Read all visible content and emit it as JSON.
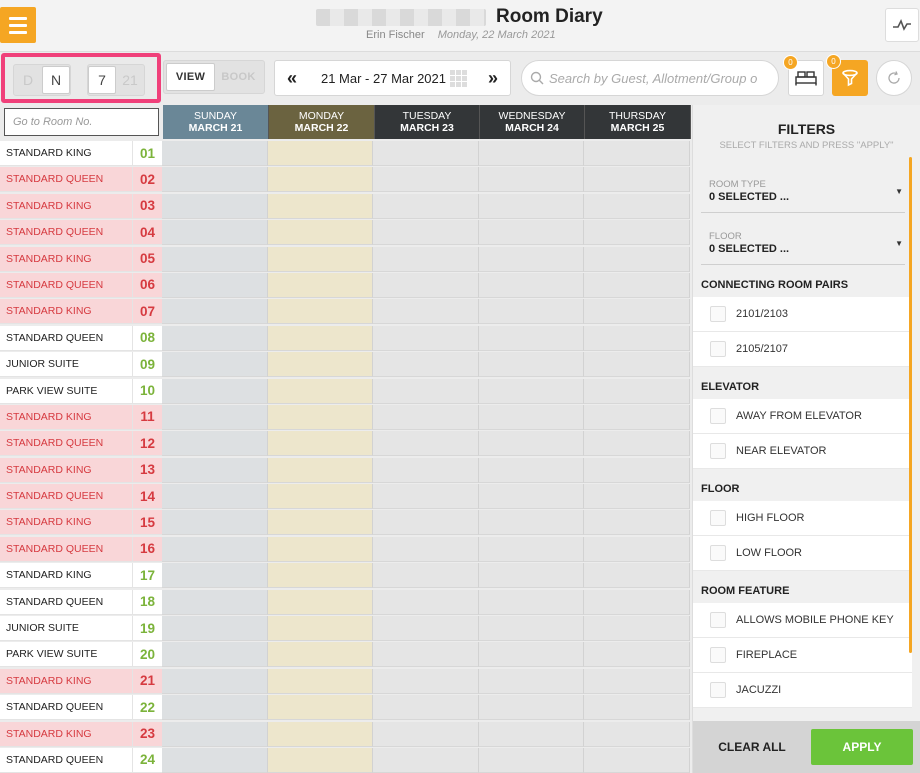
{
  "header": {
    "title": "Room Diary",
    "user": "Erin Fischer",
    "date": "Monday, 22 March 2021"
  },
  "toolbar": {
    "mode_d": "D",
    "mode_n": "N",
    "days_7": "7",
    "days_21": "21",
    "view_label": "VIEW",
    "book_label": "BOOK",
    "prev_icon": "«",
    "next_icon": "»",
    "date_range": "21 Mar - 27 Mar 2021",
    "search_placeholder": "Search by Guest, Allotment/Group o",
    "bed_badge": "0",
    "filter_badge": "0",
    "accent_color": "#f5a623",
    "highlight_color": "#f0407a"
  },
  "grid": {
    "room_search_placeholder": "Go to Room No.",
    "days": [
      {
        "day": "SUNDAY",
        "date": "MARCH 21",
        "color": "#6a8797"
      },
      {
        "day": "MONDAY",
        "date": "MARCH 22",
        "color": "#6b6340"
      },
      {
        "day": "TUESDAY",
        "date": "MARCH 23",
        "color": "#333638"
      },
      {
        "day": "WEDNESDAY",
        "date": "MARCH 24",
        "color": "#333638"
      },
      {
        "day": "THURSDAY",
        "date": "MARCH 25",
        "color": "#333638"
      }
    ],
    "rooms": [
      {
        "type": "STANDARD KING",
        "number": "01",
        "dirty": false
      },
      {
        "type": "STANDARD QUEEN",
        "number": "02",
        "dirty": true
      },
      {
        "type": "STANDARD KING",
        "number": "03",
        "dirty": true
      },
      {
        "type": "STANDARD QUEEN",
        "number": "04",
        "dirty": true
      },
      {
        "type": "STANDARD KING",
        "number": "05",
        "dirty": true
      },
      {
        "type": "STANDARD QUEEN",
        "number": "06",
        "dirty": true
      },
      {
        "type": "STANDARD KING",
        "number": "07",
        "dirty": true
      },
      {
        "type": "STANDARD QUEEN",
        "number": "08",
        "dirty": false
      },
      {
        "type": "JUNIOR SUITE",
        "number": "09",
        "dirty": false
      },
      {
        "type": "PARK VIEW SUITE",
        "number": "10",
        "dirty": false
      },
      {
        "type": "STANDARD KING",
        "number": "11",
        "dirty": true
      },
      {
        "type": "STANDARD QUEEN",
        "number": "12",
        "dirty": true
      },
      {
        "type": "STANDARD KING",
        "number": "13",
        "dirty": true
      },
      {
        "type": "STANDARD QUEEN",
        "number": "14",
        "dirty": true
      },
      {
        "type": "STANDARD KING",
        "number": "15",
        "dirty": true
      },
      {
        "type": "STANDARD QUEEN",
        "number": "16",
        "dirty": true
      },
      {
        "type": "STANDARD KING",
        "number": "17",
        "dirty": false
      },
      {
        "type": "STANDARD QUEEN",
        "number": "18",
        "dirty": false
      },
      {
        "type": "JUNIOR SUITE",
        "number": "19",
        "dirty": false
      },
      {
        "type": "PARK VIEW SUITE",
        "number": "20",
        "dirty": false
      },
      {
        "type": "STANDARD KING",
        "number": "21",
        "dirty": true
      },
      {
        "type": "STANDARD QUEEN",
        "number": "22",
        "dirty": false
      },
      {
        "type": "STANDARD KING",
        "number": "23",
        "dirty": true
      },
      {
        "type": "STANDARD QUEEN",
        "number": "24",
        "dirty": false
      }
    ]
  },
  "filters": {
    "title": "FILTERS",
    "subtitle": "SELECT FILTERS AND PRESS \"APPLY\"",
    "room_type_label": "ROOM TYPE",
    "room_type_value": "0 SELECTED ...",
    "floor_label": "FLOOR",
    "floor_value": "0 SELECTED ...",
    "sections": [
      {
        "title": "CONNECTING ROOM PAIRS",
        "options": [
          "2101/2103",
          "2105/2107"
        ]
      },
      {
        "title": "ELEVATOR",
        "options": [
          "AWAY FROM ELEVATOR",
          "NEAR ELEVATOR"
        ]
      },
      {
        "title": "FLOOR",
        "options": [
          "HIGH FLOOR",
          "LOW FLOOR"
        ]
      },
      {
        "title": "ROOM FEATURE",
        "options": [
          "ALLOWS MOBILE PHONE KEY",
          "FIREPLACE",
          "JACUZZI"
        ]
      }
    ],
    "clear_label": "CLEAR ALL",
    "apply_label": "APPLY",
    "apply_color": "#6bc43a"
  }
}
